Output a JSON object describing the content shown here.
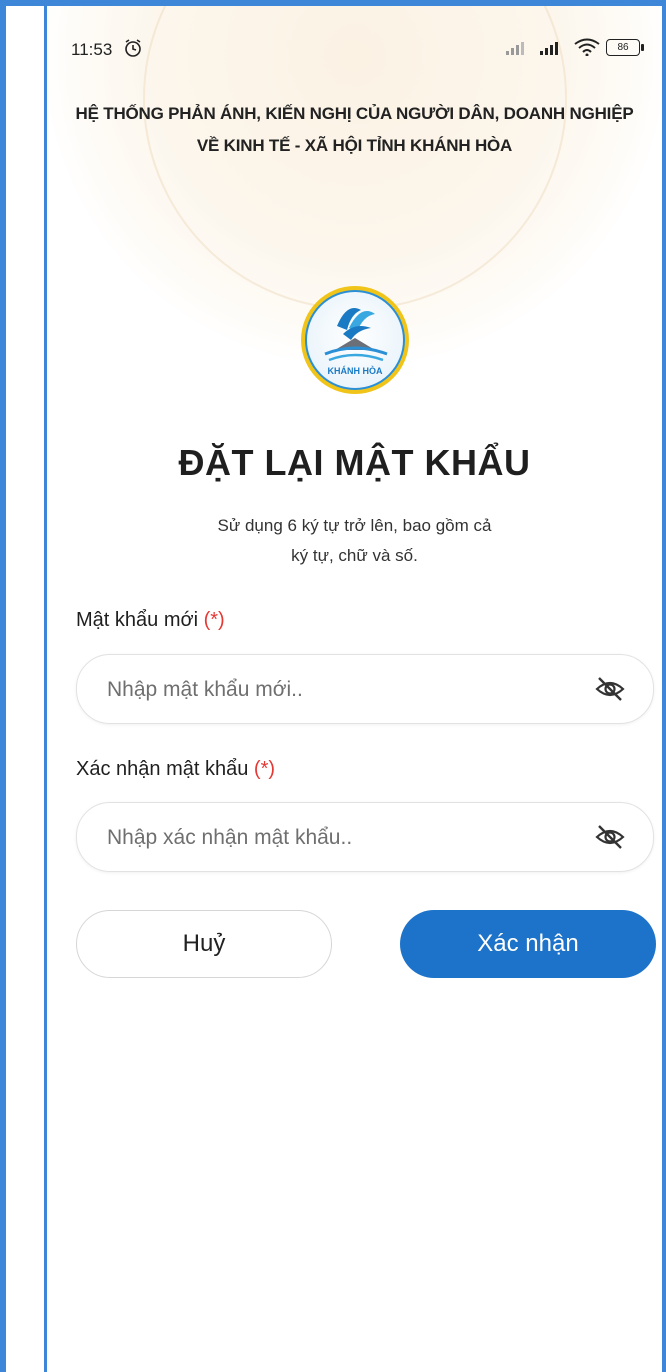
{
  "status_bar": {
    "time": "11:53",
    "battery": "86"
  },
  "header": {
    "line1": "HỆ THỐNG PHẢN ÁNH, KIẾN NGHỊ CỦA NGƯỜI DÂN, DOANH NGHIỆP",
    "line2": "VỀ KINH TẾ - XÃ HỘI TỈNH KHÁNH HÒA"
  },
  "logo": {
    "text": "KHÁNH HÒA"
  },
  "page": {
    "title": "ĐẶT LẠI MẬT KHẨU",
    "subtitle_line1": "Sử dụng 6 ký tự trở lên, bao gồm cả",
    "subtitle_line2": "ký tự, chữ và số."
  },
  "form": {
    "new_password": {
      "label": "Mật khẩu mới",
      "required_mark": "(*)",
      "placeholder": "Nhập mật khẩu mới..",
      "value": ""
    },
    "confirm_password": {
      "label": "Xác nhận mật khẩu",
      "required_mark": "(*)",
      "placeholder": "Nhập xác nhận mật khẩu..",
      "value": ""
    }
  },
  "actions": {
    "cancel_label": "Huỷ",
    "confirm_label": "Xác nhận"
  },
  "colors": {
    "primary": "#1d73c9",
    "required": "#e53935",
    "frame": "#3d86d8"
  },
  "icons": [
    "alarm-icon",
    "signal-icon",
    "wifi-icon",
    "battery-icon",
    "eye-off-icon"
  ]
}
